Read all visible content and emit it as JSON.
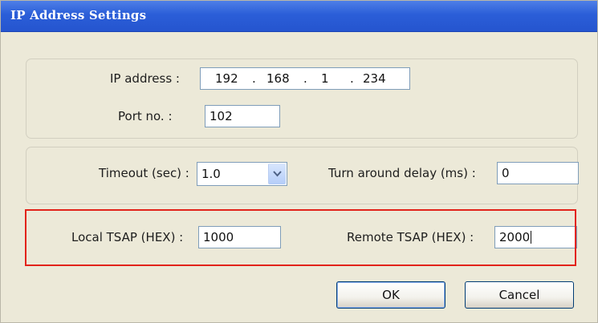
{
  "window": {
    "title": "IP Address Settings"
  },
  "ip_group": {
    "ip_label": "IP address :",
    "ip_octets": [
      "192",
      "168",
      "1",
      "234"
    ],
    "port_label": "Port no. :",
    "port_value": "102"
  },
  "timing_group": {
    "timeout_label": "Timeout (sec) :",
    "timeout_value": "1.0",
    "turnaround_label": "Turn around delay (ms) :",
    "turnaround_value": "0"
  },
  "tsap_group": {
    "local_label": "Local TSAP (HEX) :",
    "local_value": "1000",
    "remote_label": "Remote TSAP (HEX) :",
    "remote_value": "2000",
    "highlight_color": "#e2231a"
  },
  "buttons": {
    "ok_label": "OK",
    "cancel_label": "Cancel"
  },
  "icons": {
    "dropdown": "chevron-down-icon"
  }
}
